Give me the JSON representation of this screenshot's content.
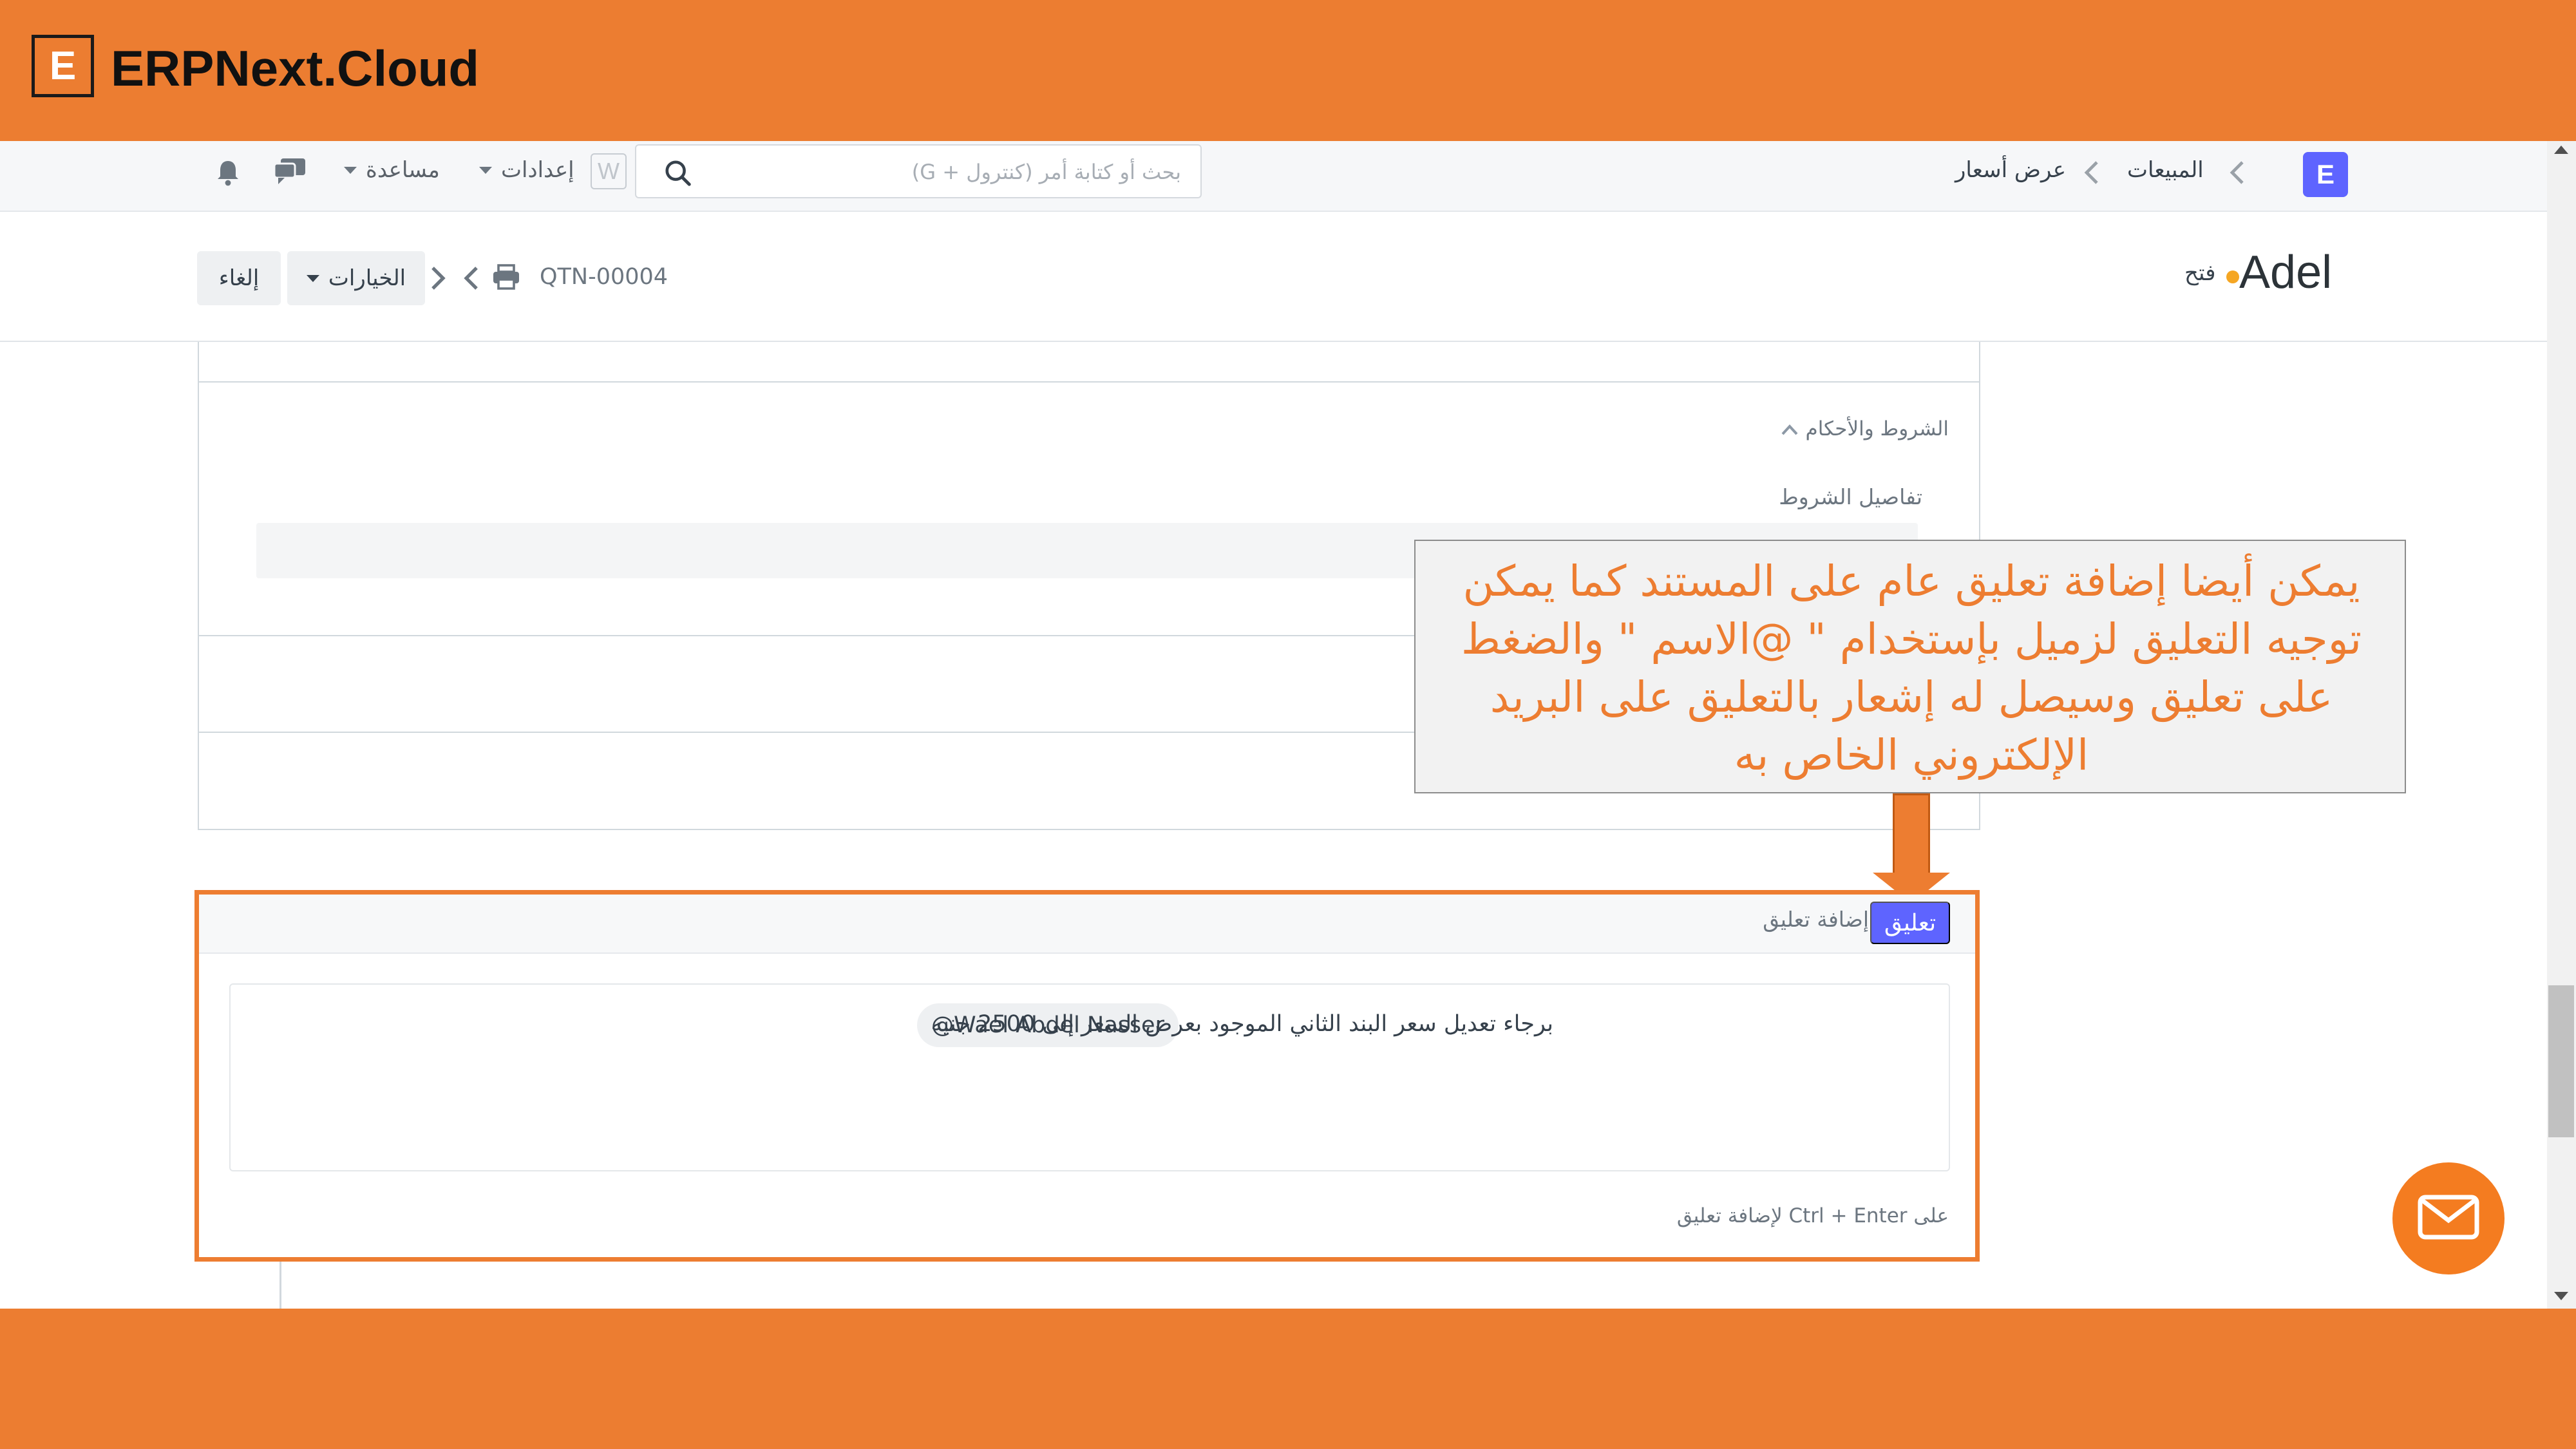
{
  "brand": {
    "logo_letter": "E",
    "name": "ERPNext.Cloud",
    "color": "#EC7D31"
  },
  "navbar": {
    "search_placeholder": "بحث أو كتابة أمر (كنترول + G)",
    "settings_label": "إعدادات",
    "help_label": "مساعدة",
    "w_icon_letter": "W",
    "app_badge_letter": "E",
    "breadcrumbs": [
      "المبيعات",
      "عرض أسعار"
    ],
    "icons": [
      "search-icon",
      "bell-icon",
      "chat-icon",
      "caret-down-icon",
      "chevron-left-icon"
    ]
  },
  "page_header": {
    "title": "Adel",
    "status": "فتح",
    "status_color": "#f5a623",
    "doc_id": "QTN-00004",
    "options_label": "الخيارات",
    "cancel_label": "إلغاء",
    "icons": [
      "print-icon",
      "chevron-left-icon",
      "chevron-right-icon",
      "caret-down-icon"
    ]
  },
  "terms_section": {
    "title": "الشروط والأحكام",
    "field_label": "تفاصيل الشروط"
  },
  "callout": {
    "text": "يمكن أيضا إضافة تعليق عام على المستند كما يمكن توجيه التعليق لزميل بإستخدام \" @الاسم \" والضغط على تعليق وسيصل له إشعار بالتعليق على البريد الإلكتروني الخاص به",
    "color": "#ED7D31"
  },
  "comment": {
    "header_label": "إضافة تعليق",
    "button_label": "تعليق",
    "mention": "@Wael Abdel Nasser",
    "text": "برجاء تعديل سعر البند الثاني الموجود بعرض السعر إلى 2500 جنيه",
    "hint": "على Ctrl + Enter لإضافة تعليق",
    "accent_color": "#5e64ff"
  },
  "fab": {
    "icon": "mail-icon"
  }
}
